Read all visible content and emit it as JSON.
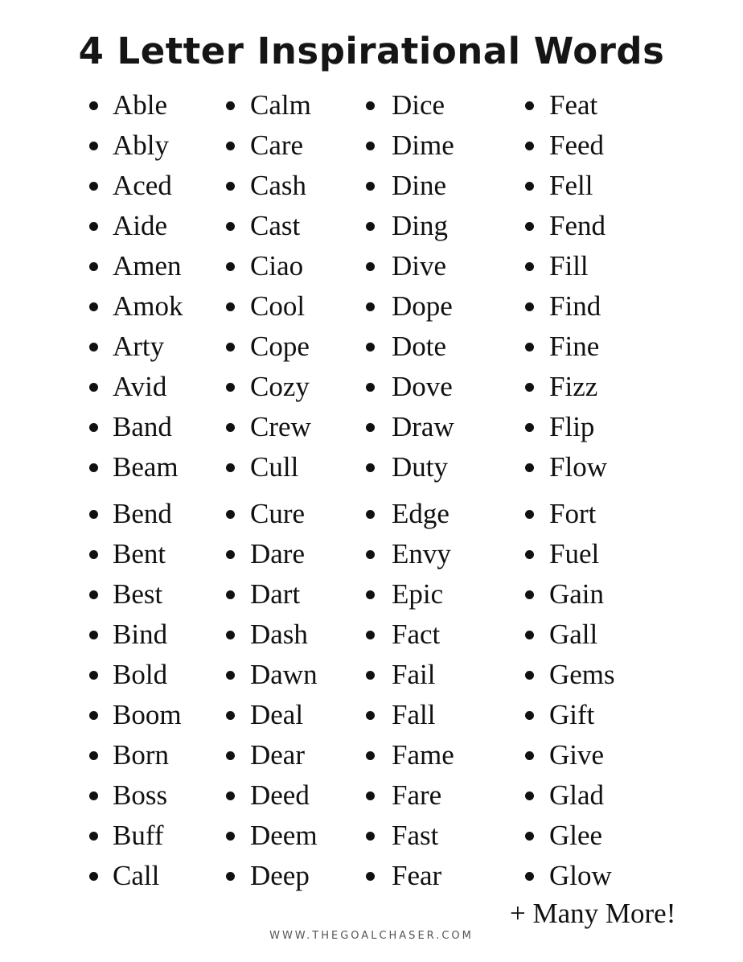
{
  "title": "4 Letter Inspirational Words",
  "columns": [
    [
      "Able",
      "Ably",
      "Aced",
      "Aide",
      "Amen",
      "Amok",
      "Arty",
      "Avid",
      "Band",
      "Beam",
      "Bend",
      "Bent",
      "Best",
      "Bind",
      "Bold",
      "Boom",
      "Born",
      "Boss",
      "Buff",
      "Call"
    ],
    [
      "Calm",
      "Care",
      "Cash",
      "Cast",
      "Ciao",
      "Cool",
      "Cope",
      "Cozy",
      "Crew",
      "Cull",
      "Cure",
      "Dare",
      "Dart",
      "Dash",
      "Dawn",
      "Deal",
      "Dear",
      "Deed",
      "Deem",
      "Deep"
    ],
    [
      "Dice",
      "Dime",
      "Dine",
      "Ding",
      "Dive",
      "Dope",
      "Dote",
      "Dove",
      "Draw",
      "Duty",
      "Edge",
      "Envy",
      "Epic",
      "Fact",
      "Fail",
      "Fall",
      "Fame",
      "Fare",
      "Fast",
      "Fear"
    ],
    [
      "Feat",
      "Feed",
      "Fell",
      "Fend",
      "Fill",
      "Find",
      "Fine",
      "Fizz",
      "Flip",
      "Flow",
      "Fort",
      "Fuel",
      "Gain",
      "Gall",
      "Gems",
      "Gift",
      "Give",
      "Glad",
      "Glee",
      "Glow"
    ]
  ],
  "more_label": "+ Many More!",
  "footer": "WWW.THEGOALCHASER.COM"
}
